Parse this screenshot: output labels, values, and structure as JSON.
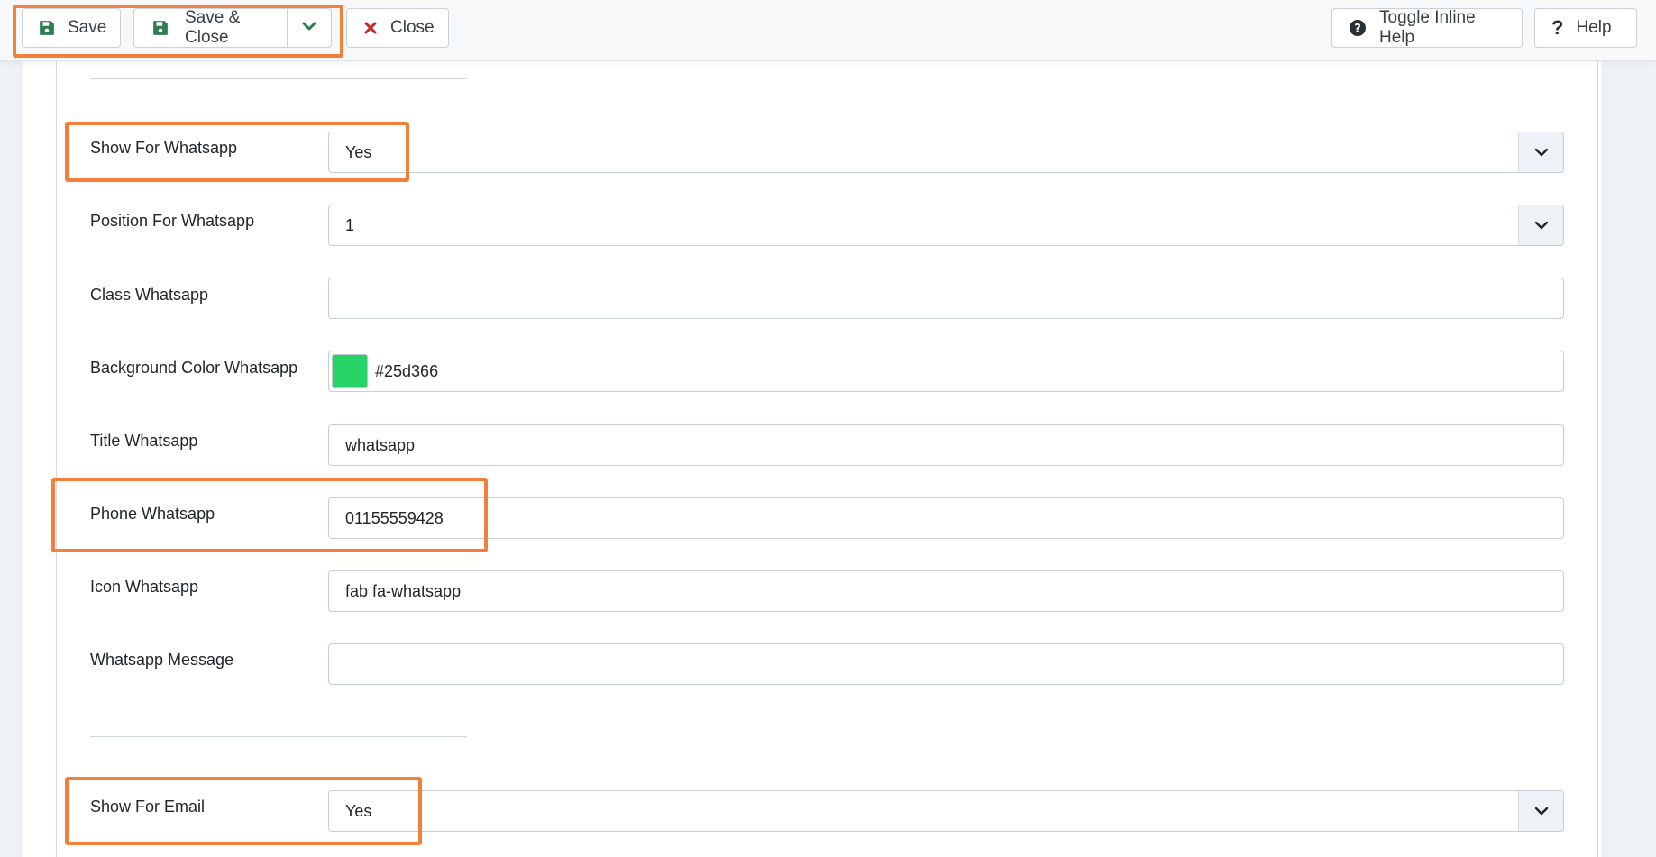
{
  "toolbar": {
    "save_label": "Save",
    "save_close_label": "Save & Close",
    "close_label": "Close",
    "toggle_help_label": "Toggle Inline Help",
    "help_label": "Help"
  },
  "fields": {
    "show_whatsapp": {
      "label": "Show For Whatsapp",
      "value": "Yes"
    },
    "position_whatsapp": {
      "label": "Position For Whatsapp",
      "value": "1"
    },
    "class_whatsapp": {
      "label": "Class Whatsapp",
      "value": ""
    },
    "bg_color_whatsapp": {
      "label": "Background Color Whatsapp",
      "value": "#25d366"
    },
    "title_whatsapp": {
      "label": "Title Whatsapp",
      "value": "whatsapp"
    },
    "phone_whatsapp": {
      "label": "Phone Whatsapp",
      "value": "01155559428"
    },
    "icon_whatsapp": {
      "label": "Icon Whatsapp",
      "value": "fab fa-whatsapp"
    },
    "whatsapp_message": {
      "label": "Whatsapp Message",
      "value": ""
    },
    "show_email": {
      "label": "Show For Email",
      "value": "Yes"
    }
  },
  "colors": {
    "swatch": "#25d366",
    "save_icon": "#2e7d4f",
    "close_icon": "#c62828",
    "highlight": "#f47f3b"
  }
}
